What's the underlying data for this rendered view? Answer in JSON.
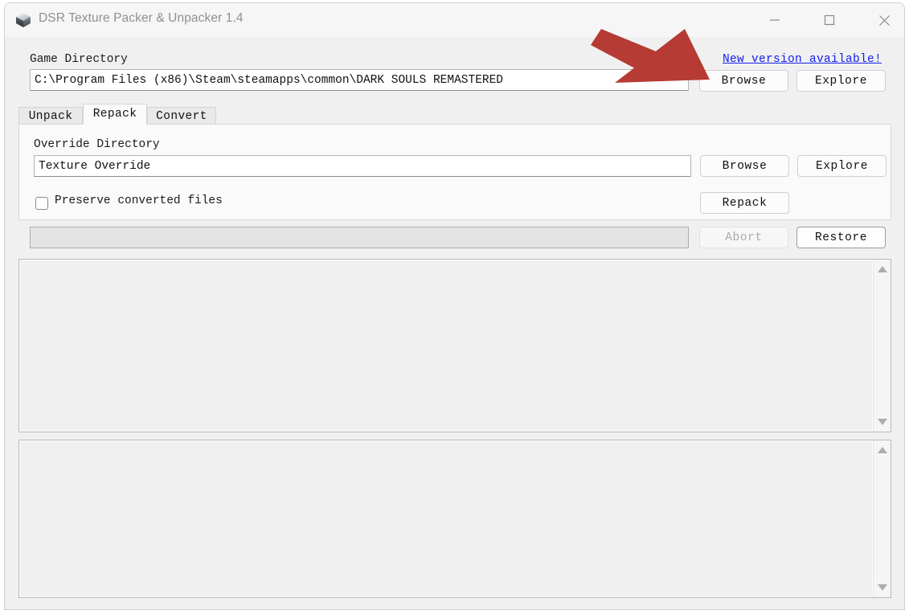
{
  "window": {
    "title": "DSR Texture Packer & Unpacker 1.4",
    "icon": "cube-icon",
    "controls": {
      "minimize": "minimize-icon",
      "maximize": "maximize-icon",
      "close": "close-icon"
    }
  },
  "header": {
    "game_directory_label": "Game Directory",
    "game_directory_value": "C:\\Program Files (x86)\\Steam\\steamapps\\common\\DARK SOULS REMASTERED",
    "game_directory_placeholder": "Game Directory",
    "browse_label": "Browse",
    "explore_label": "Explore",
    "update_link": "New version available!"
  },
  "tabs": [
    {
      "label": "Unpack",
      "active": false
    },
    {
      "label": "Repack",
      "active": true
    },
    {
      "label": "Convert",
      "active": false
    }
  ],
  "repack_tab": {
    "override_directory_label": "Override Directory",
    "override_directory_value": "Texture Override",
    "override_directory_placeholder": "Override Directory",
    "browse_label": "Browse",
    "explore_label": "Explore",
    "preserve_checkbox_label": "Preserve converted files",
    "preserve_checkbox_checked": false,
    "repack_label": "Repack"
  },
  "status_row": {
    "progress_value": 0,
    "progress_text": "",
    "abort_label": "Abort",
    "abort_enabled": false,
    "restore_label": "Restore",
    "restore_enabled": true
  },
  "panes": [
    {
      "name": "output-log-pane",
      "content": ""
    },
    {
      "name": "detail-log-pane",
      "content": ""
    }
  ],
  "annotation": {
    "type": "arrow",
    "color": "#b63b34",
    "points_to": "browse-button-game-directory"
  }
}
